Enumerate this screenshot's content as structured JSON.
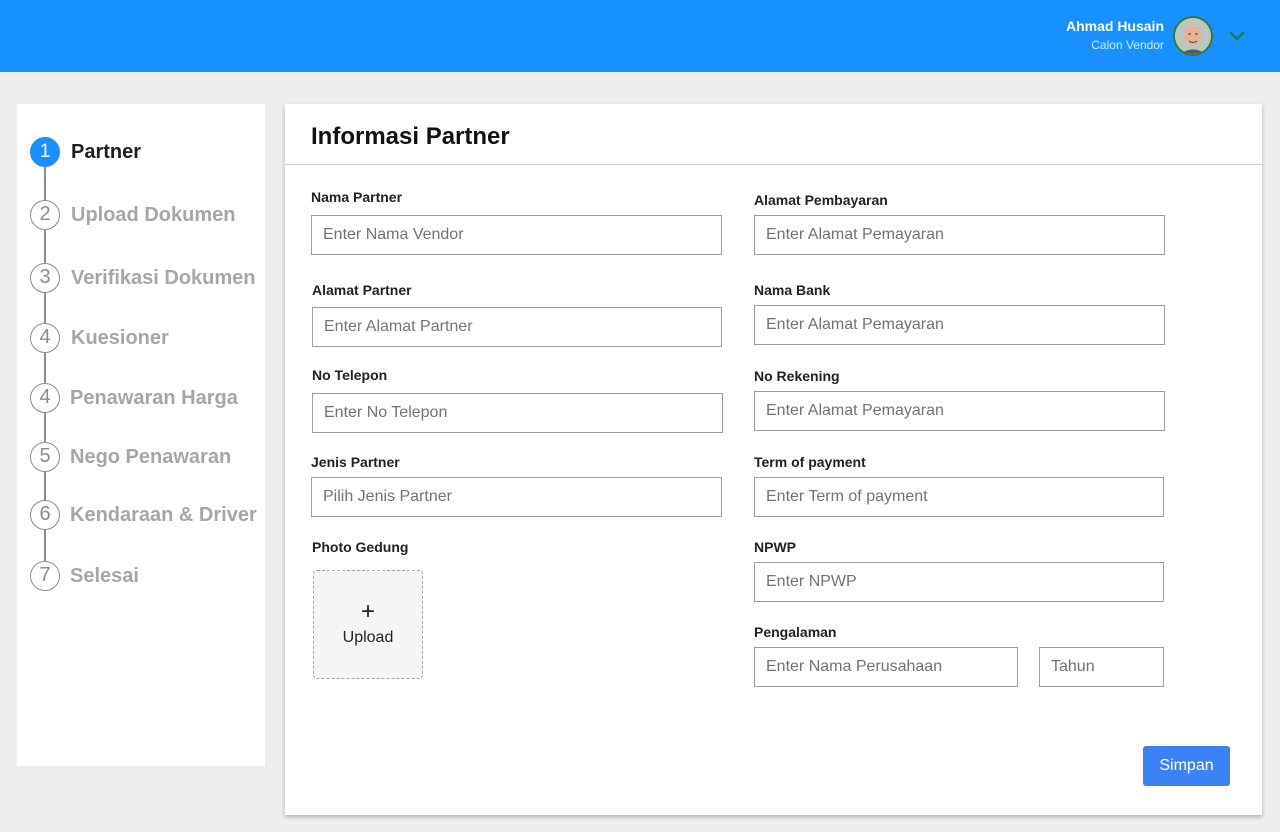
{
  "header": {
    "user_name": "Ahmad Husain",
    "user_role": "Calon Vendor",
    "brand_color": "#1890ff"
  },
  "stepper": {
    "steps": [
      {
        "number": "1",
        "label": "Partner",
        "active": true
      },
      {
        "number": "2",
        "label": "Upload Dokumen",
        "active": false
      },
      {
        "number": "3",
        "label": "Verifikasi Dokumen",
        "active": false
      },
      {
        "number": "4",
        "label": "Kuesioner",
        "active": false
      },
      {
        "number": "4",
        "label": "Penawaran Harga",
        "active": false
      },
      {
        "number": "5",
        "label": "Nego Penawaran",
        "active": false
      },
      {
        "number": "6",
        "label": "Kendaraan & Driver",
        "active": false
      },
      {
        "number": "7",
        "label": "Selesai",
        "active": false
      }
    ]
  },
  "form": {
    "title": "Informasi Partner",
    "nama_partner": {
      "label": "Nama Partner",
      "placeholder": "Enter Nama Vendor",
      "value": ""
    },
    "alamat_partner": {
      "label": "Alamat Partner",
      "placeholder": "Enter Alamat Partner",
      "value": ""
    },
    "no_telepon": {
      "label": "No Telepon",
      "placeholder": "Enter No Telepon",
      "value": ""
    },
    "jenis_partner": {
      "label": "Jenis Partner",
      "placeholder": "Pilih Jenis Partner",
      "value": ""
    },
    "photo_gedung": {
      "label": "Photo Gedung",
      "upload_icon": "+",
      "upload_text": "Upload"
    },
    "alamat_pembayaran": {
      "label": "Alamat Pembayaran",
      "placeholder": "Enter Alamat Pemayaran",
      "value": ""
    },
    "nama_bank": {
      "label": "Nama Bank",
      "placeholder": "Enter Alamat Pemayaran",
      "value": ""
    },
    "no_rekening": {
      "label": "No Rekening",
      "placeholder": "Enter Alamat Pemayaran",
      "value": ""
    },
    "term_of_payment": {
      "label": "Term of payment",
      "placeholder": "Enter Term of payment",
      "value": ""
    },
    "npwp": {
      "label": "NPWP",
      "placeholder": "Enter NPWP",
      "value": ""
    },
    "pengalaman": {
      "label": "Pengalaman",
      "perusahaan_placeholder": "Enter Nama Perusahaan",
      "tahun_placeholder": "Tahun"
    },
    "save_label": "Simpan"
  }
}
